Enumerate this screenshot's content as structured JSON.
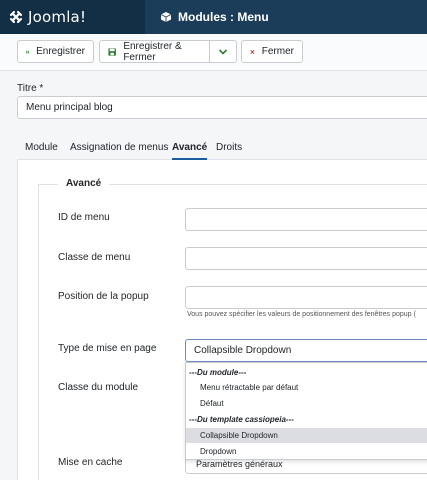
{
  "brand": {
    "name": "Joomla!"
  },
  "header": {
    "title": "Modules : Menu"
  },
  "toolbar": {
    "save_label": "Enregistrer",
    "save_close_label": "Enregistrer & Fermer",
    "close_label": "Fermer"
  },
  "form": {
    "title_label": "Titre *",
    "title_value": "Menu principal blog"
  },
  "tabs": [
    "Module",
    "Assignation de menus",
    "Avancé",
    "Droits"
  ],
  "advanced": {
    "legend": "Avancé",
    "menu_id_label": "ID de menu",
    "menu_class_label": "Classe de menu",
    "popup_position_label": "Position de la popup",
    "popup_help": "Vous pouvez spécifier les valeurs de positionnement des fenêtres popup (",
    "layout_label": "Type de mise en page",
    "layout_value": "Collapsible Dropdown",
    "module_class_label": "Classe du module",
    "cache_label": "Mise en cache",
    "cache_value": "Paramètres généraux"
  },
  "layout_options": [
    "---Du module---",
    "Menu rétractable par défaut",
    "Défaut",
    "---Du template cassiopeia---",
    "Collapsible Dropdown",
    "Dropdown"
  ],
  "colors": {
    "topbar": "#1c3d5a",
    "logo_bg": "#132f46",
    "save_icon": "#2e7d32",
    "close_icon": "#c62828",
    "active_tab": "#1a5ea0"
  }
}
